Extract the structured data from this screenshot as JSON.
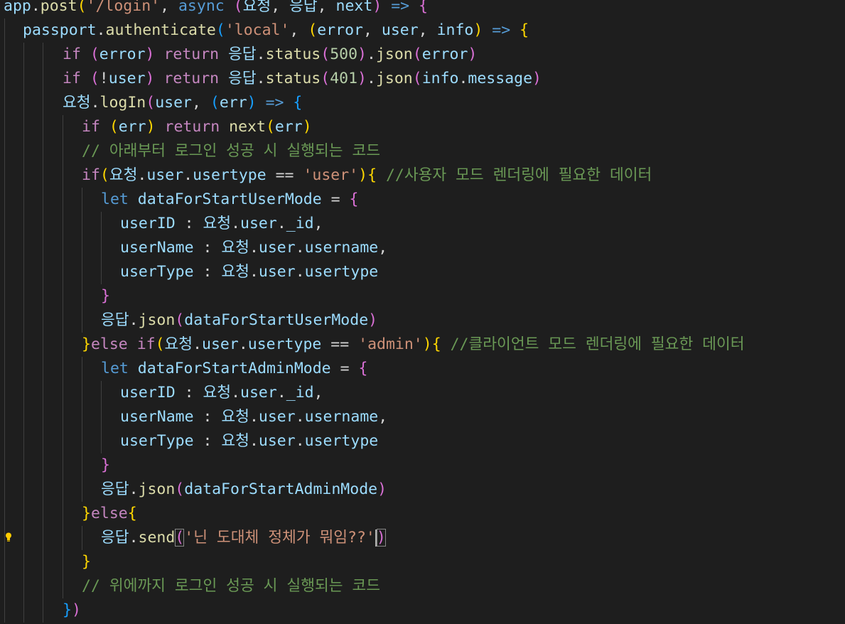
{
  "editor": {
    "colors": {
      "background": "#1e1e1e",
      "default": "#d4d4d4",
      "variable": "#9cdcfe",
      "function": "#dcdcaa",
      "keyword": "#569cd6",
      "control": "#c586c0",
      "string": "#ce9178",
      "number": "#b5cea8",
      "comment": "#6a9955",
      "bracket1": "#ffd700",
      "bracket2": "#da70d6",
      "bracket3": "#179fff"
    },
    "lightbulb_icon": "lightbulb-icon",
    "lines": [
      {
        "indent": 0,
        "tokens": [
          {
            "t": "app",
            "c": "variable"
          },
          {
            "t": ".",
            "c": "default"
          },
          {
            "t": "post",
            "c": "function"
          },
          {
            "t": "(",
            "c": "bracket1"
          },
          {
            "t": "'/login'",
            "c": "string"
          },
          {
            "t": ", ",
            "c": "default"
          },
          {
            "t": "async",
            "c": "keyword"
          },
          {
            "t": " ",
            "c": "default"
          },
          {
            "t": "(",
            "c": "bracket2"
          },
          {
            "t": "요청",
            "c": "variable"
          },
          {
            "t": ", ",
            "c": "default"
          },
          {
            "t": "응답",
            "c": "variable"
          },
          {
            "t": ", ",
            "c": "default"
          },
          {
            "t": "next",
            "c": "variable"
          },
          {
            "t": ")",
            "c": "bracket2"
          },
          {
            "t": " ",
            "c": "default"
          },
          {
            "t": "=>",
            "c": "keyword"
          },
          {
            "t": " ",
            "c": "default"
          },
          {
            "t": "{",
            "c": "bracket2"
          }
        ]
      },
      {
        "indent": 1,
        "tokens": [
          {
            "t": "passport",
            "c": "variable"
          },
          {
            "t": ".",
            "c": "default"
          },
          {
            "t": "authenticate",
            "c": "function"
          },
          {
            "t": "(",
            "c": "bracket3"
          },
          {
            "t": "'local'",
            "c": "string"
          },
          {
            "t": ", ",
            "c": "default"
          },
          {
            "t": "(",
            "c": "bracket1"
          },
          {
            "t": "error",
            "c": "variable"
          },
          {
            "t": ", ",
            "c": "default"
          },
          {
            "t": "user",
            "c": "variable"
          },
          {
            "t": ", ",
            "c": "default"
          },
          {
            "t": "info",
            "c": "variable"
          },
          {
            "t": ")",
            "c": "bracket1"
          },
          {
            "t": " ",
            "c": "default"
          },
          {
            "t": "=>",
            "c": "keyword"
          },
          {
            "t": " ",
            "c": "default"
          },
          {
            "t": "{",
            "c": "bracket1"
          }
        ]
      },
      {
        "indent": 3,
        "tokens": [
          {
            "t": "if",
            "c": "control"
          },
          {
            "t": " ",
            "c": "default"
          },
          {
            "t": "(",
            "c": "bracket2"
          },
          {
            "t": "error",
            "c": "variable"
          },
          {
            "t": ")",
            "c": "bracket2"
          },
          {
            "t": " ",
            "c": "default"
          },
          {
            "t": "return",
            "c": "control"
          },
          {
            "t": " ",
            "c": "default"
          },
          {
            "t": "응답",
            "c": "variable"
          },
          {
            "t": ".",
            "c": "default"
          },
          {
            "t": "status",
            "c": "function"
          },
          {
            "t": "(",
            "c": "bracket2"
          },
          {
            "t": "500",
            "c": "number"
          },
          {
            "t": ")",
            "c": "bracket2"
          },
          {
            "t": ".",
            "c": "default"
          },
          {
            "t": "json",
            "c": "function"
          },
          {
            "t": "(",
            "c": "bracket2"
          },
          {
            "t": "error",
            "c": "variable"
          },
          {
            "t": ")",
            "c": "bracket2"
          }
        ]
      },
      {
        "indent": 3,
        "tokens": [
          {
            "t": "if",
            "c": "control"
          },
          {
            "t": " ",
            "c": "default"
          },
          {
            "t": "(",
            "c": "bracket2"
          },
          {
            "t": "!",
            "c": "default"
          },
          {
            "t": "user",
            "c": "variable"
          },
          {
            "t": ")",
            "c": "bracket2"
          },
          {
            "t": " ",
            "c": "default"
          },
          {
            "t": "return",
            "c": "control"
          },
          {
            "t": " ",
            "c": "default"
          },
          {
            "t": "응답",
            "c": "variable"
          },
          {
            "t": ".",
            "c": "default"
          },
          {
            "t": "status",
            "c": "function"
          },
          {
            "t": "(",
            "c": "bracket2"
          },
          {
            "t": "401",
            "c": "number"
          },
          {
            "t": ")",
            "c": "bracket2"
          },
          {
            "t": ".",
            "c": "default"
          },
          {
            "t": "json",
            "c": "function"
          },
          {
            "t": "(",
            "c": "bracket2"
          },
          {
            "t": "info",
            "c": "variable"
          },
          {
            "t": ".",
            "c": "default"
          },
          {
            "t": "message",
            "c": "variable"
          },
          {
            "t": ")",
            "c": "bracket2"
          }
        ]
      },
      {
        "indent": 3,
        "tokens": [
          {
            "t": "요청",
            "c": "variable"
          },
          {
            "t": ".",
            "c": "default"
          },
          {
            "t": "logIn",
            "c": "function"
          },
          {
            "t": "(",
            "c": "bracket2"
          },
          {
            "t": "user",
            "c": "variable"
          },
          {
            "t": ", ",
            "c": "default"
          },
          {
            "t": "(",
            "c": "bracket3"
          },
          {
            "t": "err",
            "c": "variable"
          },
          {
            "t": ")",
            "c": "bracket3"
          },
          {
            "t": " ",
            "c": "default"
          },
          {
            "t": "=>",
            "c": "keyword"
          },
          {
            "t": " ",
            "c": "default"
          },
          {
            "t": "{",
            "c": "bracket3"
          }
        ]
      },
      {
        "indent": 4,
        "tokens": [
          {
            "t": "if",
            "c": "control"
          },
          {
            "t": " ",
            "c": "default"
          },
          {
            "t": "(",
            "c": "bracket1"
          },
          {
            "t": "err",
            "c": "variable"
          },
          {
            "t": ")",
            "c": "bracket1"
          },
          {
            "t": " ",
            "c": "default"
          },
          {
            "t": "return",
            "c": "control"
          },
          {
            "t": " ",
            "c": "default"
          },
          {
            "t": "next",
            "c": "function"
          },
          {
            "t": "(",
            "c": "bracket1"
          },
          {
            "t": "err",
            "c": "variable"
          },
          {
            "t": ")",
            "c": "bracket1"
          }
        ]
      },
      {
        "indent": 4,
        "tokens": [
          {
            "t": "// 아래부터 로그인 성공 시 실행되는 코드",
            "c": "comment"
          }
        ]
      },
      {
        "indent": 4,
        "tokens": [
          {
            "t": "if",
            "c": "control"
          },
          {
            "t": "(",
            "c": "bracket1"
          },
          {
            "t": "요청",
            "c": "variable"
          },
          {
            "t": ".",
            "c": "default"
          },
          {
            "t": "user",
            "c": "variable"
          },
          {
            "t": ".",
            "c": "default"
          },
          {
            "t": "usertype",
            "c": "variable"
          },
          {
            "t": " == ",
            "c": "default"
          },
          {
            "t": "'user'",
            "c": "string"
          },
          {
            "t": ")",
            "c": "bracket1"
          },
          {
            "t": "{",
            "c": "bracket1"
          },
          {
            "t": " ",
            "c": "default"
          },
          {
            "t": "//사용자 모드 렌더링에 필요한 데이터",
            "c": "comment"
          }
        ]
      },
      {
        "indent": 5,
        "tokens": [
          {
            "t": "let",
            "c": "keyword"
          },
          {
            "t": " ",
            "c": "default"
          },
          {
            "t": "dataForStartUserMode",
            "c": "variable"
          },
          {
            "t": " = ",
            "c": "default"
          },
          {
            "t": "{",
            "c": "bracket2"
          }
        ]
      },
      {
        "indent": 6,
        "tokens": [
          {
            "t": "userID",
            "c": "variable"
          },
          {
            "t": " : ",
            "c": "default"
          },
          {
            "t": "요청",
            "c": "variable"
          },
          {
            "t": ".",
            "c": "default"
          },
          {
            "t": "user",
            "c": "variable"
          },
          {
            "t": ".",
            "c": "default"
          },
          {
            "t": "_id",
            "c": "variable"
          },
          {
            "t": ",",
            "c": "default"
          }
        ]
      },
      {
        "indent": 6,
        "tokens": [
          {
            "t": "userName",
            "c": "variable"
          },
          {
            "t": " : ",
            "c": "default"
          },
          {
            "t": "요청",
            "c": "variable"
          },
          {
            "t": ".",
            "c": "default"
          },
          {
            "t": "user",
            "c": "variable"
          },
          {
            "t": ".",
            "c": "default"
          },
          {
            "t": "username",
            "c": "variable"
          },
          {
            "t": ",",
            "c": "default"
          }
        ]
      },
      {
        "indent": 6,
        "tokens": [
          {
            "t": "userType",
            "c": "variable"
          },
          {
            "t": " : ",
            "c": "default"
          },
          {
            "t": "요청",
            "c": "variable"
          },
          {
            "t": ".",
            "c": "default"
          },
          {
            "t": "user",
            "c": "variable"
          },
          {
            "t": ".",
            "c": "default"
          },
          {
            "t": "usertype",
            "c": "variable"
          }
        ]
      },
      {
        "indent": 5,
        "tokens": [
          {
            "t": "}",
            "c": "bracket2"
          }
        ]
      },
      {
        "indent": 5,
        "tokens": [
          {
            "t": "응답",
            "c": "variable"
          },
          {
            "t": ".",
            "c": "default"
          },
          {
            "t": "json",
            "c": "function"
          },
          {
            "t": "(",
            "c": "bracket2"
          },
          {
            "t": "dataForStartUserMode",
            "c": "variable"
          },
          {
            "t": ")",
            "c": "bracket2"
          }
        ]
      },
      {
        "indent": 4,
        "tokens": [
          {
            "t": "}",
            "c": "bracket1"
          },
          {
            "t": "else",
            "c": "control"
          },
          {
            "t": " ",
            "c": "default"
          },
          {
            "t": "if",
            "c": "control"
          },
          {
            "t": "(",
            "c": "bracket1"
          },
          {
            "t": "요청",
            "c": "variable"
          },
          {
            "t": ".",
            "c": "default"
          },
          {
            "t": "user",
            "c": "variable"
          },
          {
            "t": ".",
            "c": "default"
          },
          {
            "t": "usertype",
            "c": "variable"
          },
          {
            "t": " == ",
            "c": "default"
          },
          {
            "t": "'admin'",
            "c": "string"
          },
          {
            "t": ")",
            "c": "bracket1"
          },
          {
            "t": "{",
            "c": "bracket1"
          },
          {
            "t": " ",
            "c": "default"
          },
          {
            "t": "//클라이언트 모드 렌더링에 필요한 데이터",
            "c": "comment"
          }
        ]
      },
      {
        "indent": 5,
        "tokens": [
          {
            "t": "let",
            "c": "keyword"
          },
          {
            "t": " ",
            "c": "default"
          },
          {
            "t": "dataForStartAdminMode",
            "c": "variable"
          },
          {
            "t": " = ",
            "c": "default"
          },
          {
            "t": "{",
            "c": "bracket2"
          }
        ]
      },
      {
        "indent": 6,
        "tokens": [
          {
            "t": "userID",
            "c": "variable"
          },
          {
            "t": " : ",
            "c": "default"
          },
          {
            "t": "요청",
            "c": "variable"
          },
          {
            "t": ".",
            "c": "default"
          },
          {
            "t": "user",
            "c": "variable"
          },
          {
            "t": ".",
            "c": "default"
          },
          {
            "t": "_id",
            "c": "variable"
          },
          {
            "t": ",",
            "c": "default"
          }
        ]
      },
      {
        "indent": 6,
        "tokens": [
          {
            "t": "userName",
            "c": "variable"
          },
          {
            "t": " : ",
            "c": "default"
          },
          {
            "t": "요청",
            "c": "variable"
          },
          {
            "t": ".",
            "c": "default"
          },
          {
            "t": "user",
            "c": "variable"
          },
          {
            "t": ".",
            "c": "default"
          },
          {
            "t": "username",
            "c": "variable"
          },
          {
            "t": ",",
            "c": "default"
          }
        ]
      },
      {
        "indent": 6,
        "tokens": [
          {
            "t": "userType",
            "c": "variable"
          },
          {
            "t": " : ",
            "c": "default"
          },
          {
            "t": "요청",
            "c": "variable"
          },
          {
            "t": ".",
            "c": "default"
          },
          {
            "t": "user",
            "c": "variable"
          },
          {
            "t": ".",
            "c": "default"
          },
          {
            "t": "usertype",
            "c": "variable"
          }
        ]
      },
      {
        "indent": 5,
        "tokens": [
          {
            "t": "}",
            "c": "bracket2"
          }
        ]
      },
      {
        "indent": 5,
        "tokens": [
          {
            "t": "응답",
            "c": "variable"
          },
          {
            "t": ".",
            "c": "default"
          },
          {
            "t": "json",
            "c": "function"
          },
          {
            "t": "(",
            "c": "bracket2"
          },
          {
            "t": "dataForStartAdminMode",
            "c": "variable"
          },
          {
            "t": ")",
            "c": "bracket2"
          }
        ]
      },
      {
        "indent": 4,
        "tokens": [
          {
            "t": "}",
            "c": "bracket1"
          },
          {
            "t": "else",
            "c": "control"
          },
          {
            "t": "{",
            "c": "bracket1"
          }
        ]
      },
      {
        "indent": 5,
        "lightbulb": true,
        "tokens": [
          {
            "t": "응답",
            "c": "variable"
          },
          {
            "t": ".",
            "c": "default"
          },
          {
            "t": "send",
            "c": "function"
          },
          {
            "t": "(",
            "c": "bracket2",
            "match": true
          },
          {
            "t": "'닌 도대체 정체가 뭐임??'",
            "c": "string"
          },
          {
            "t": ")",
            "c": "bracket2",
            "match": true,
            "cursor_before": true
          }
        ]
      },
      {
        "indent": 4,
        "tokens": [
          {
            "t": "}",
            "c": "bracket1"
          }
        ]
      },
      {
        "indent": 4,
        "tokens": [
          {
            "t": "// 위에까지 로그인 성공 시 실행되는 코드",
            "c": "comment"
          }
        ]
      },
      {
        "indent": 3,
        "tokens": [
          {
            "t": "}",
            "c": "bracket3"
          },
          {
            "t": ")",
            "c": "bracket2"
          }
        ]
      }
    ]
  }
}
